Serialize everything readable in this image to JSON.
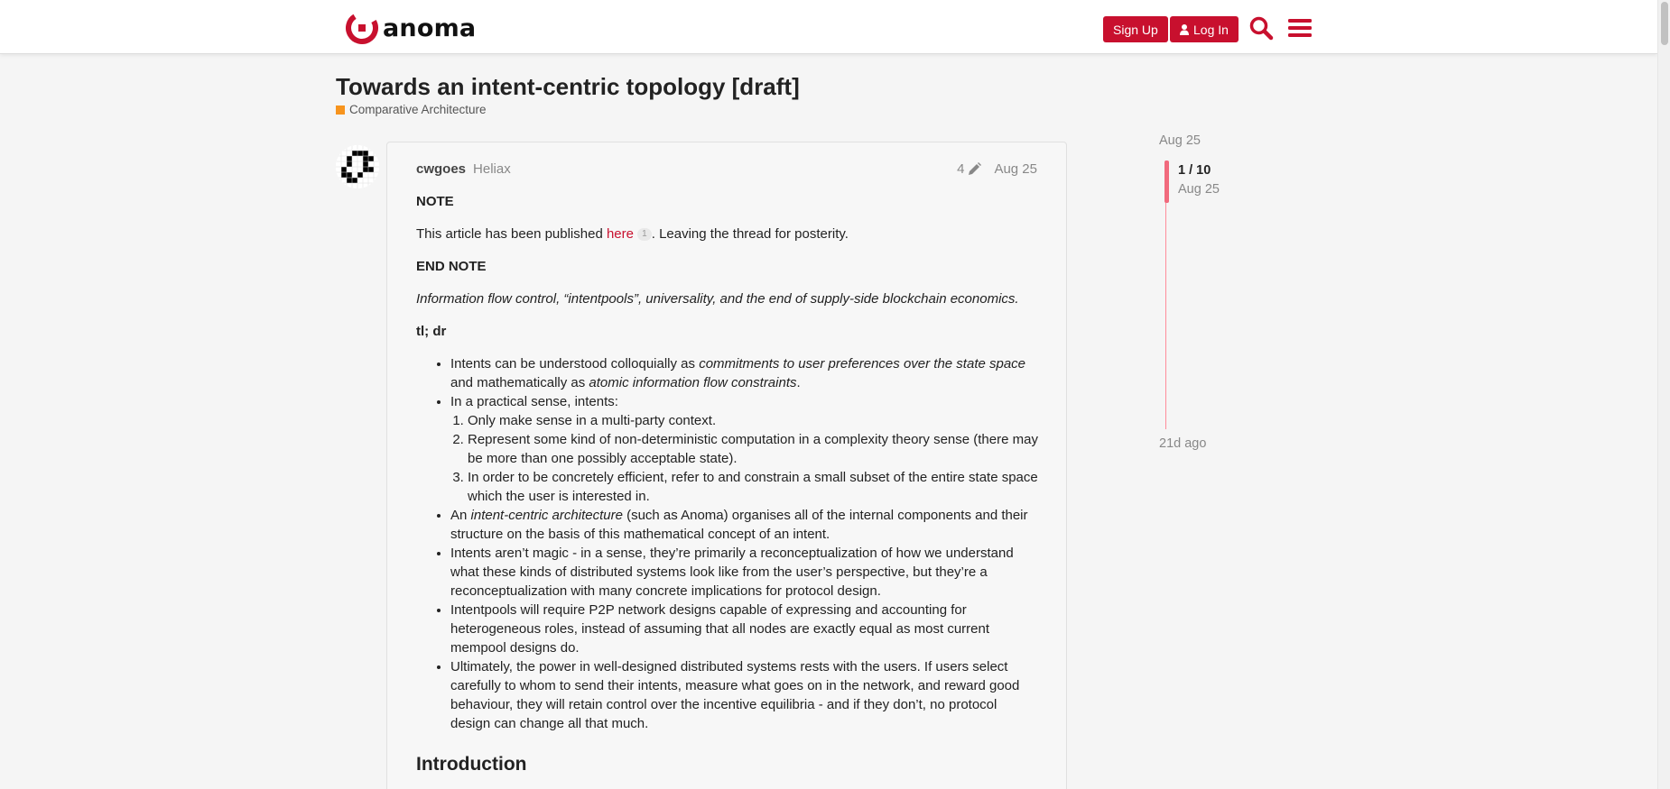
{
  "header": {
    "logo_text": "anoma",
    "signup_label": "Sign Up",
    "login_label": "Log In"
  },
  "topic": {
    "title": "Towards an intent-centric topology [draft]",
    "category": "Comparative Architecture",
    "category_color": "#f7941d"
  },
  "post": {
    "username": "cwgoes",
    "user_title": "Heliax",
    "edit_count": "4",
    "date": "Aug 25",
    "note_label": "NOTE",
    "published_pre": "This article has been published ",
    "published_link": "here",
    "published_clicks": "1",
    "published_post": ". Leaving the thread for posterity.",
    "end_note_label": "END NOTE",
    "subtitle": "Information flow control, “intentpools”, universality, and the end of supply-side blockchain economics.",
    "tldr_label": "tl; dr",
    "b1_pre": "Intents can be understood colloquially as ",
    "b1_em1": "commitments to user preferences over the state space",
    "b1_mid": " and mathematically as ",
    "b1_em2": "atomic information flow constraints",
    "b1_post": ".",
    "b2": "In a practical sense, intents:",
    "b2_sub1": "Only make sense in a multi-party context.",
    "b2_sub2": "Represent some kind of non-deterministic computation in a complexity theory sense (there may be more than one possibly acceptable state).",
    "b2_sub3": "In order to be concretely efficient, refer to and constrain a small subset of the entire state space which the user is interested in.",
    "b3_pre": "An ",
    "b3_em": "intent-centric architecture",
    "b3_post": " (such as Anoma) organises all of the internal components and their structure on the basis of this mathematical concept of an intent.",
    "b4": "Intents aren’t magic - in a sense, they’re primarily a reconceptualization of how we understand what these kinds of distributed systems look like from the user’s perspective, but they’re a reconceptualization with many concrete implications for protocol design.",
    "b5": "Intentpools will require P2P network designs capable of expressing and accounting for heterogeneous roles, instead of assuming that all nodes are exactly equal as most current mempool designs do.",
    "b6": "Ultimately, the power in well-designed distributed systems rests with the users. If users select carefully to whom to send their intents, measure what goes on in the network, and reward good behaviour, they will retain control over the incentive equilibria - and if they don’t, no protocol design can change all that much.",
    "heading_intro": "Introduction"
  },
  "timeline": {
    "top_date": "Aug 25",
    "position": "1 / 10",
    "position_date": "Aug 25",
    "bottom_label": "21d ago"
  },
  "colors": {
    "brand": "#c8102e",
    "timeline": "#f16a7d"
  }
}
